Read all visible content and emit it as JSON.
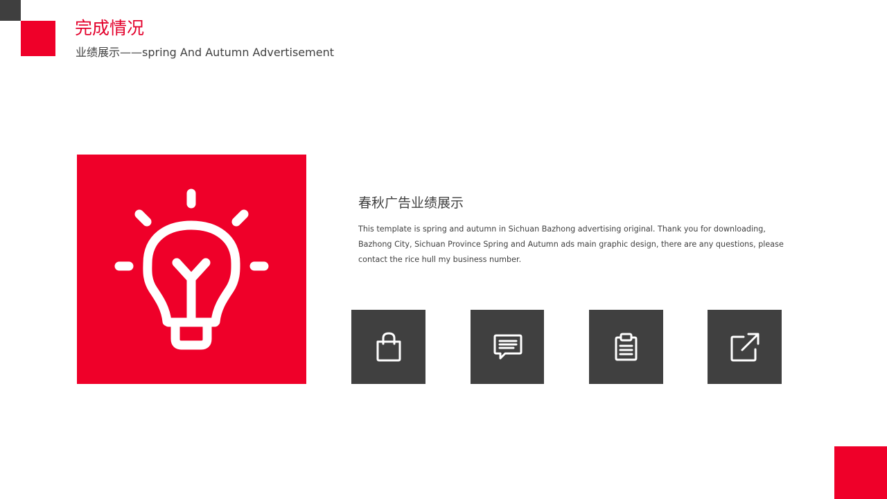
{
  "header": {
    "title": "完成情况",
    "subtitle": "业绩展示——spring And Autumn Advertisement"
  },
  "content": {
    "heading": "春秋广告业绩展示",
    "body": "This template is spring and autumn in Sichuan  Bazhong advertising original. Thank you for downloading, Bazhong City, Sichuan Province Spring and Autumn ads main graphic design, there are any questions, please contact the rice hull my business  number."
  },
  "hero": {
    "icon": "lightbulb-icon"
  },
  "tiles": [
    {
      "icon": "shopping-bag-icon"
    },
    {
      "icon": "chat-message-icon"
    },
    {
      "icon": "clipboard-icon"
    },
    {
      "icon": "external-link-icon"
    }
  ],
  "colors": {
    "accent_red": "#ef0029",
    "title_red": "#e3002b",
    "dark_gray": "#404040",
    "text": "#404040",
    "background": "#ffffff"
  }
}
